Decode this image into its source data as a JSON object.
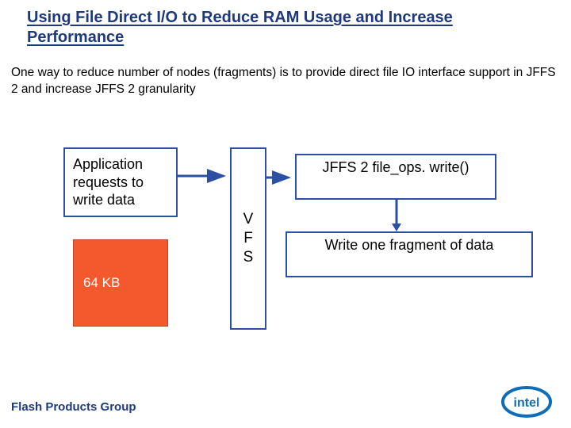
{
  "title": "Using File Direct I/O to Reduce RAM Usage and Increase Performance",
  "description": "One way to reduce number of nodes (fragments) is to provide direct file IO interface support in JFFS 2 and increase JFFS 2 granularity",
  "diagram": {
    "app_box": "Application requests to write data",
    "data_size": "64 KB",
    "vfs": "V\nF\nS",
    "jffs": "JFFS 2 file_ops. write()",
    "fragment": "Write one fragment of data"
  },
  "footer": "Flash Products Group",
  "brand": "intel",
  "colors": {
    "heading": "#1e3a7b",
    "box_border": "#2b4fa2",
    "data_block": "#f4592d"
  }
}
